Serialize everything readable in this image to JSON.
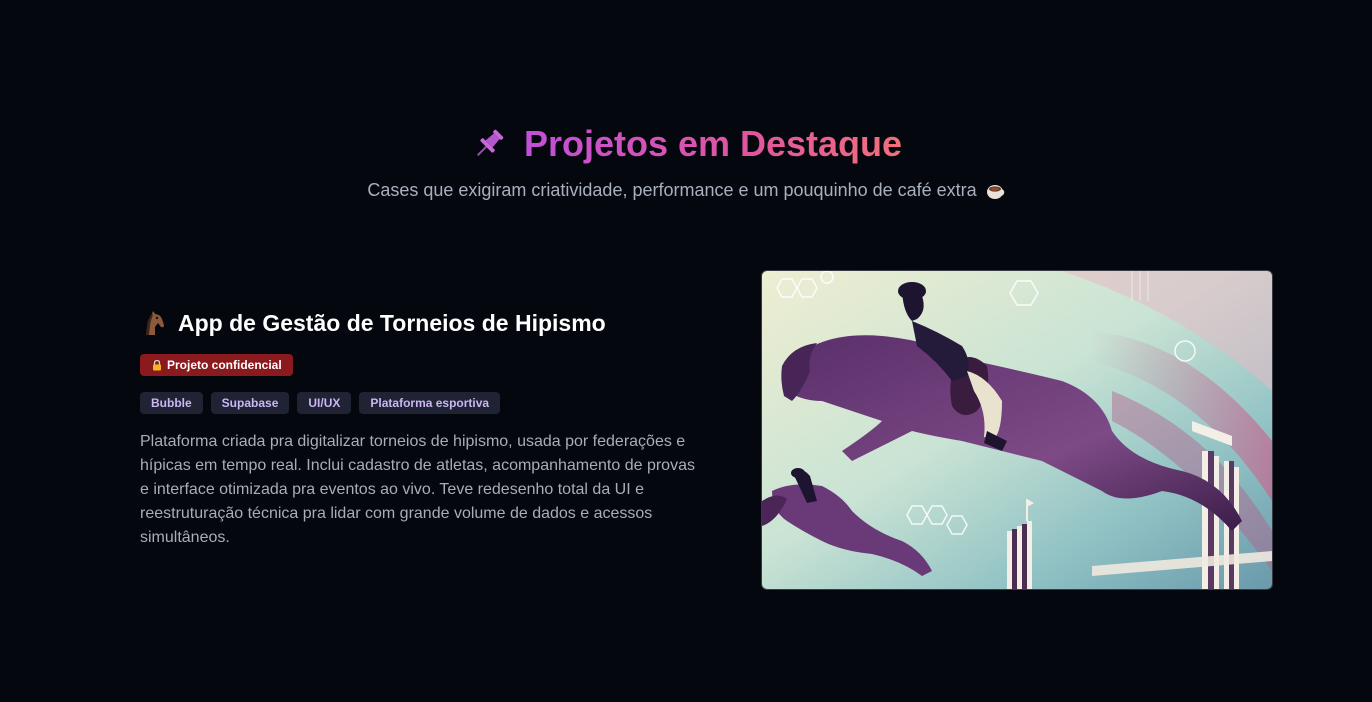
{
  "header": {
    "pin_icon": "pushpin-icon",
    "title": "Projetos em Destaque",
    "subtitle": "Cases que exigiram criatividade, performance e um pouquinho de café extra",
    "coffee_icon": "coffee-icon",
    "title_gradient": [
      "#c24fd9",
      "#e0569e",
      "#f0707a"
    ]
  },
  "project": {
    "icon": "horse-icon",
    "title": "App de Gestão de Torneios de Hipismo",
    "badge": {
      "icon": "lock-icon",
      "label": "Projeto confidencial",
      "color": "#8a1a1d"
    },
    "tags": [
      "Bubble",
      "Supabase",
      "UI/UX",
      "Plataforma esportiva"
    ],
    "description": "Plataforma criada pra digitalizar torneios de hipismo, usada por federações e hípicas em tempo real. Inclui cadastro de atletas, acompanhamento de provas e interface otimizada pra eventos ao vivo. Teve redesenho total da UI e reestruturação técnica pra lidar com grande volume de dados e acessos simultâneos.",
    "image": "show-jumping-illustration"
  },
  "colors": {
    "background": "#05070e",
    "tag_background": "#1f2333",
    "tag_text": "#cbb5f5"
  }
}
